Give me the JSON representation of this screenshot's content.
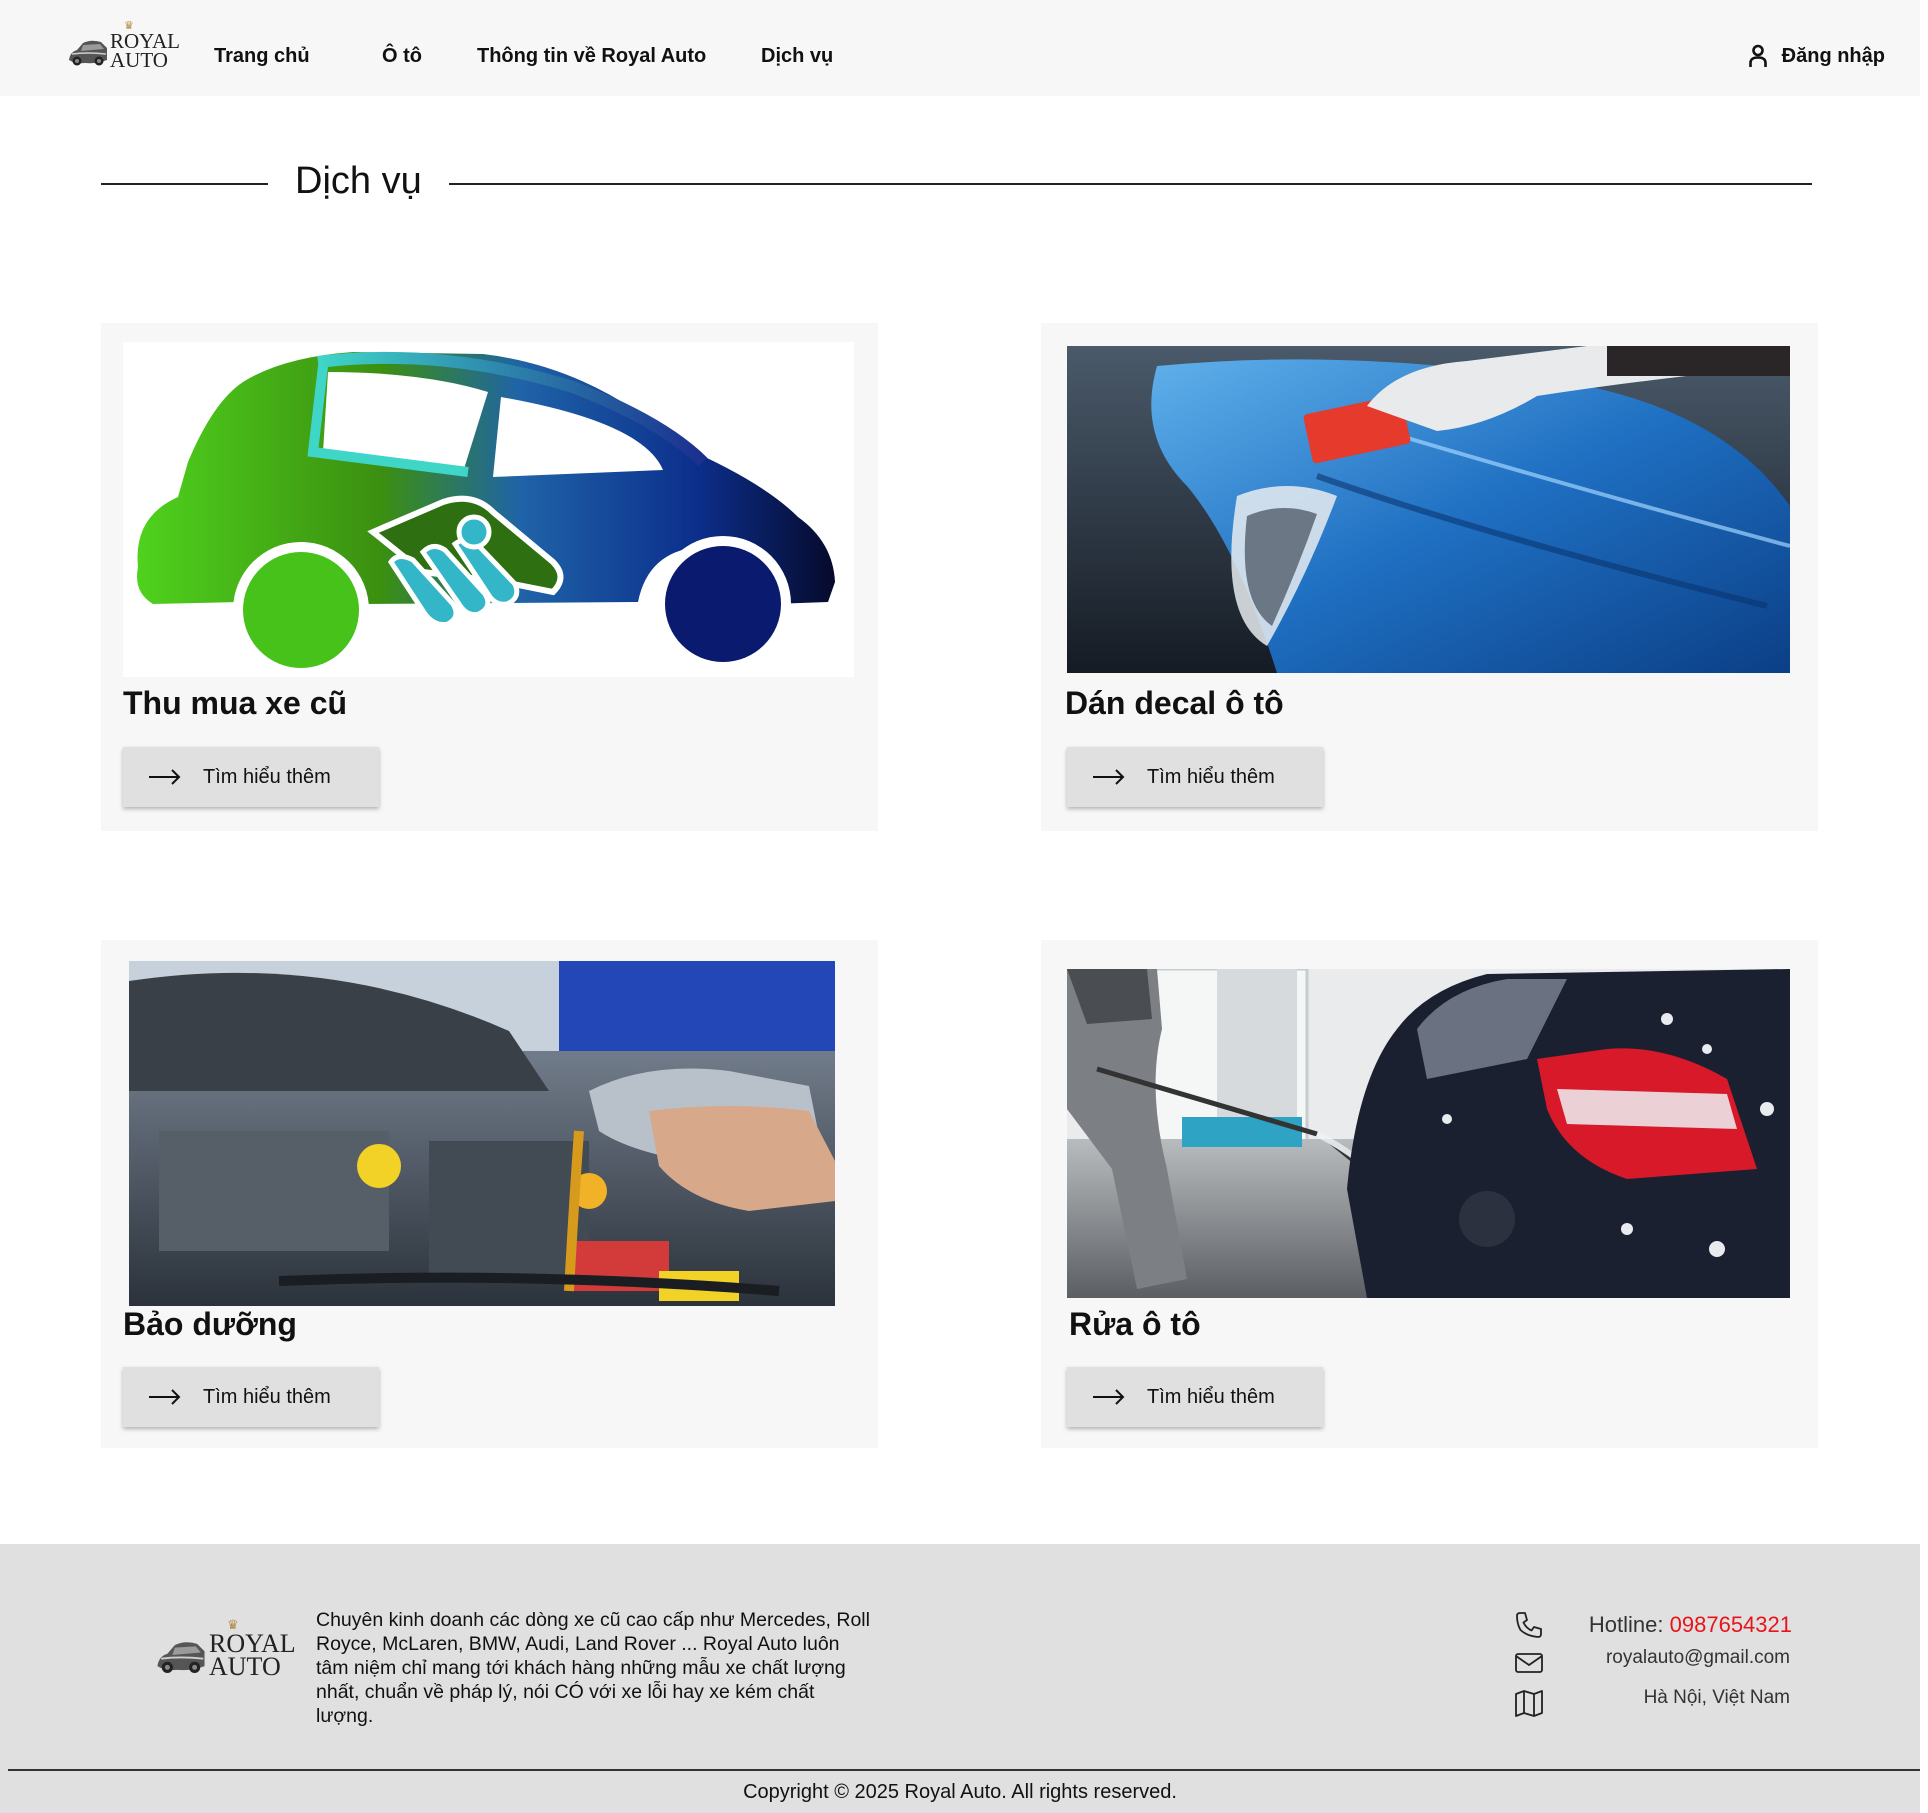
{
  "brand": {
    "line1": "ROYAL",
    "line2": "AUTO"
  },
  "nav": [
    {
      "label": "Trang chủ"
    },
    {
      "label": "Ô tô"
    },
    {
      "label": "Thông tin về Royal Auto"
    },
    {
      "label": "Dịch vụ"
    }
  ],
  "login_label": "Đăng nhập",
  "section_title": "Dịch vụ",
  "services": [
    {
      "title": "Thu mua xe cũ",
      "image": "car-buyback-handshake-illustration",
      "button": "Tìm hiểu thêm"
    },
    {
      "title": "Dán decal ô tô",
      "image": "blue-car-wrap-application-photo",
      "button": "Tìm hiểu thêm"
    },
    {
      "title": "Bảo dưỡng",
      "image": "engine-oil-change-photo",
      "button": "Tìm hiểu thêm"
    },
    {
      "title": "Rửa ô tô",
      "image": "car-pressure-wash-photo",
      "button": "Tìm hiểu thêm"
    }
  ],
  "footer": {
    "description": "Chuyên kinh doanh các dòng xe cũ cao cấp như Mercedes, Roll Royce, McLaren, BMW, Audi, Land Rover ... Royal Auto luôn tâm niệm chỉ mang tới khách hàng những mẫu xe chất lượng nhất, chuẩn về pháp lý, nói CÓ với xe lỗi hay xe kém chất lượng.",
    "hotline_label": "Hotline:",
    "hotline_number": "0987654321",
    "email": "royalauto@gmail.com",
    "address": "Hà Nội, Việt Nam",
    "copyright": "Copyright © 2025 Royal Auto. All rights reserved."
  },
  "colors": {
    "hotline": "#e8141a",
    "header_bg": "#f7f7f7",
    "footer_bg": "#e0e0e0",
    "card_bg": "#f7f7f7",
    "button_bg": "#e0e0e0"
  }
}
